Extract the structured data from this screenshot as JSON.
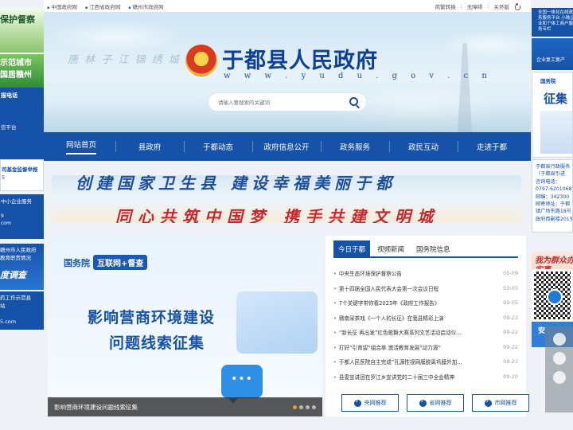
{
  "topbar": {
    "links": [
      "中国政府网",
      "江西省政府网",
      "赣州市政府网"
    ],
    "simplified": "简繁转换",
    "accessibility": "无障碍",
    "care_mode": "关怀版"
  },
  "header": {
    "calligraphy": "唐 林 子 江 锦 绣 城",
    "site_title": "于都县人民政府",
    "site_url": "w w w . y u d u . g o v . c n",
    "search_placeholder": "请输入要搜索的关键词"
  },
  "nav": {
    "items": [
      "网站首页",
      "县政府",
      "于都动态",
      "政府信息公开",
      "政务服务",
      "政民互动",
      "走进于都"
    ],
    "active_index": 0
  },
  "slogan": {
    "line1": "创建国家卫生县 建设幸福美丽于都",
    "line2": "同心共筑中国梦 携手共建文明城"
  },
  "feature": {
    "badge_org": "国务院",
    "badge_label": "互联网+督查",
    "headline1": "影响营商环境建设",
    "headline2": "问题线索征集",
    "caption": "影响营商环境建设问题线索征集"
  },
  "news": {
    "tabs": [
      "今日于都",
      "视频新闻",
      "国务院信息"
    ],
    "active_tab": 0,
    "items": [
      {
        "title": "中央生态环境保护督察公告",
        "date": "05-09"
      },
      {
        "title": "第十四届全国人民代表大会第一次会议日程",
        "date": "03-05"
      },
      {
        "title": "7个关键字带你看2023年《政府工作报告》",
        "date": "03-05"
      },
      {
        "title": "赣南采茶戏《一个人的长征》在我县精彩上演",
        "date": "09-22"
      },
      {
        "title": "“新长征 再出发”红色歌舞大赛系列文艺活动启动仪...",
        "date": "09-22"
      },
      {
        "title": "打好“引育留”组合拳 激活教育发展“动力源”",
        "date": "09-22"
      },
      {
        "title": "于都人民医院自主完成“孔源性视网膜脱离巩膜外加...",
        "date": "09-21"
      },
      {
        "title": "县委宣讲团在罗江乡宣讲党的二十届三中全会精神",
        "date": "09-20"
      }
    ],
    "buttons": [
      "央网推荐",
      "省网推荐",
      "市网推荐"
    ]
  },
  "left_rail": {
    "b1": "保护督察",
    "b2_l1": "示范城市",
    "b2_l2": "国居赣州",
    "b3_a": "报电话",
    "b3_b": "信平台",
    "b4_a": "司基金监督举报",
    "b4_b": "5",
    "b5_a": "中小企业服务",
    "b5_b": "9\ncom",
    "b6_a": "赣州市人民政府\n教育职责情况",
    "b6_b": "度调查",
    "b7_a": "药工作示范县\n站",
    "b7_b": "5.com"
  },
  "right_rail": {
    "r1": "全国一体化在线政务服务平台 小微企业和个体工商户服务专栏",
    "r2": "企业复工复产",
    "r3_a": "国务院",
    "r3_b": "征集",
    "r4": "于都县行政服务\n（于都县引进\n咨询电话：\n0797-6201068\n邮编：342300\n邮寄地址：于都\n镇广场东路18号\n政府西副楼201室",
    "r5": "我为群众办实事",
    "r7": "安"
  }
}
